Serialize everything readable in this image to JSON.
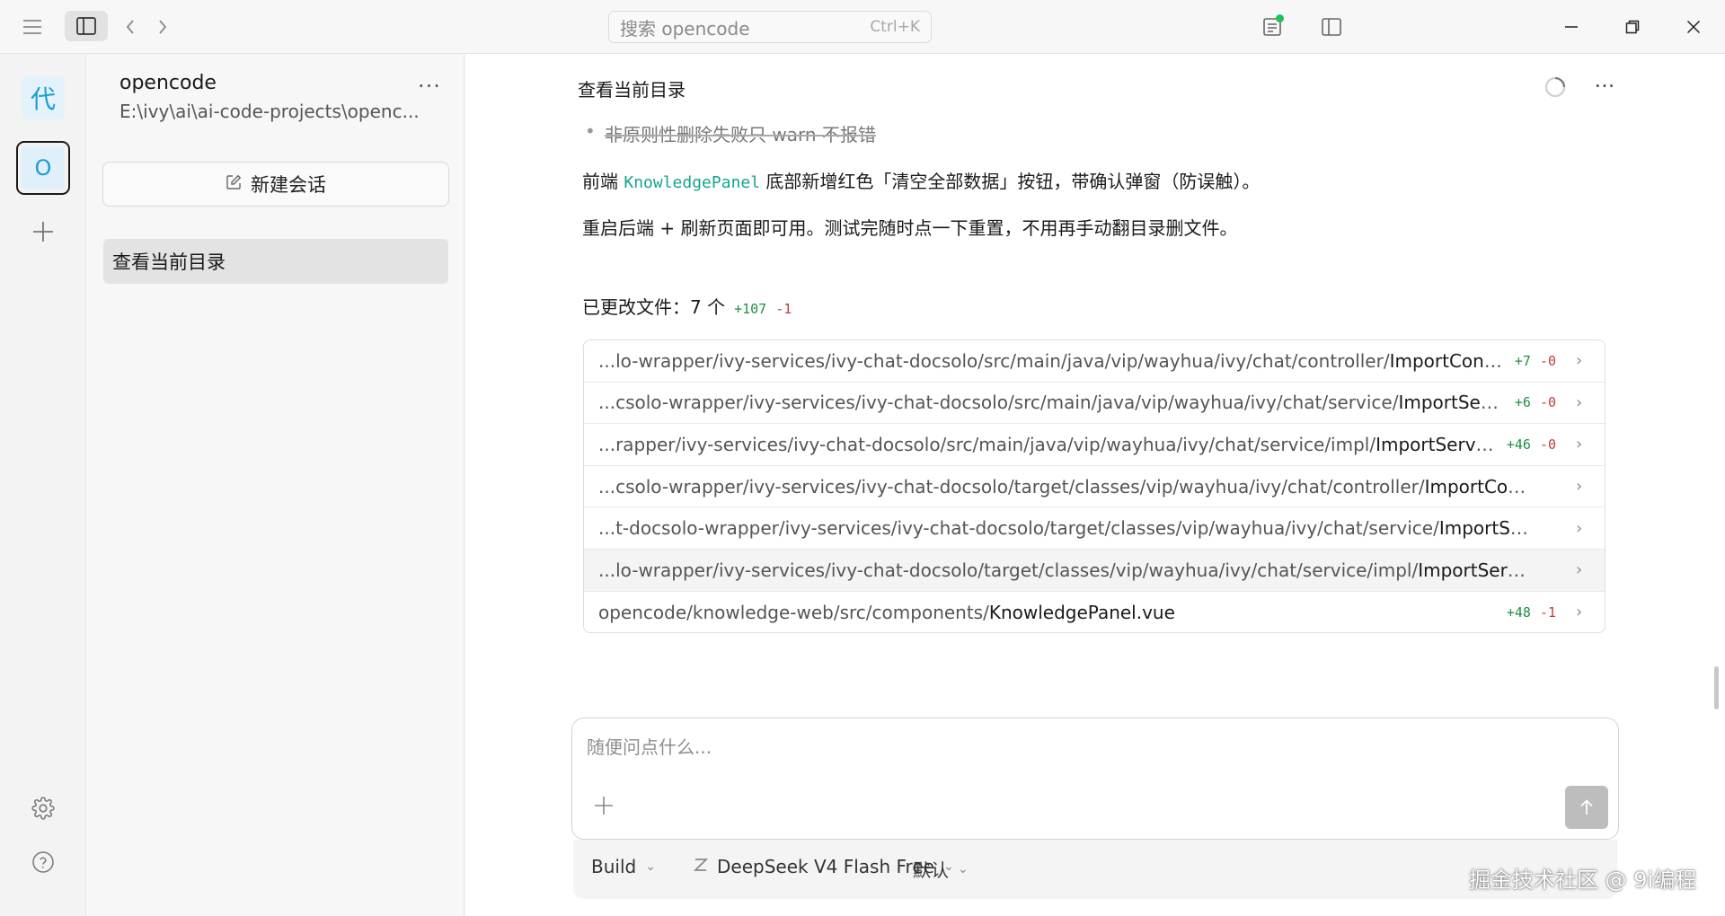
{
  "titlebar": {
    "search_placeholder": "搜索 opencode",
    "search_shortcut": "Ctrl+K",
    "icons": [
      "hamburger-menu-icon",
      "sidebar-toggle-icon",
      "chevron-left-icon",
      "chevron-right-icon",
      "review-changes-icon",
      "side-panel-icon",
      "window-minimize-icon",
      "window-restore-icon",
      "window-close-icon"
    ],
    "status_dot_color": "#22c05a"
  },
  "rail": {
    "workspace_avatar": "代",
    "project_avatar": "O",
    "accent_color": "#1a9ed6"
  },
  "sidebar": {
    "project_name": "opencode",
    "project_path": "E:\\ivy\\ai\\ai-code-projects\\openc...",
    "more": "···",
    "new_session_label": "新建会话",
    "sessions": [
      {
        "title": "查看当前目录"
      }
    ]
  },
  "conversation": {
    "title": "查看当前目录",
    "more": "···",
    "bullet": "非原则性删除失败只 warn 不报错",
    "para1_pre": "前端 ",
    "para1_code": "KnowledgePanel",
    "para1_post": " 底部新增红色「清空全部数据」按钮，带确认弹窗（防误触）。",
    "para2": "重启后端 + 刷新页面即可用。测试完随时点一下重置，不用再手动翻目录删文件。",
    "changed_files_label": "已更改文件：7 个",
    "changed_files_add": "+107",
    "changed_files_del": "-1",
    "files": [
      {
        "dir": "...lo-wrapper/ivy-services/ivy-chat-docsolo/src/main/java/vip/wayhua/ivy/chat/controller/",
        "name": "ImportControll...",
        "add": "+7",
        "del": "-0"
      },
      {
        "dir": "...csolo-wrapper/ivy-services/ivy-chat-docsolo/src/main/java/vip/wayhua/ivy/chat/service/",
        "name": "ImportServic...",
        "add": "+6",
        "del": "-0"
      },
      {
        "dir": "...rapper/ivy-services/ivy-chat-docsolo/src/main/java/vip/wayhua/ivy/chat/service/impl/",
        "name": "ImportServiceI...",
        "add": "+46",
        "del": "-0"
      },
      {
        "dir": "...csolo-wrapper/ivy-services/ivy-chat-docsolo/target/classes/vip/wayhua/ivy/chat/controller/",
        "name": "ImportControlle...",
        "add": "",
        "del": ""
      },
      {
        "dir": "...t-docsolo-wrapper/ivy-services/ivy-chat-docsolo/target/classes/vip/wayhua/ivy/chat/service/",
        "name": "ImportService....",
        "add": "",
        "del": ""
      },
      {
        "dir": "...lo-wrapper/ivy-services/ivy-chat-docsolo/target/classes/vip/wayhua/ivy/chat/service/impl/",
        "name": "ImportServiceIm...",
        "add": "",
        "del": ""
      },
      {
        "dir": "opencode/knowledge-web/src/components/",
        "name": "KnowledgePanel.vue",
        "add": "+48",
        "del": "-1"
      }
    ]
  },
  "composer": {
    "placeholder": "随便问点什么...",
    "agent": "Build",
    "model": "DeepSeek V4 Flash Free",
    "mode": "默认"
  },
  "watermark": "掘金技术社区 @ 9i编程"
}
